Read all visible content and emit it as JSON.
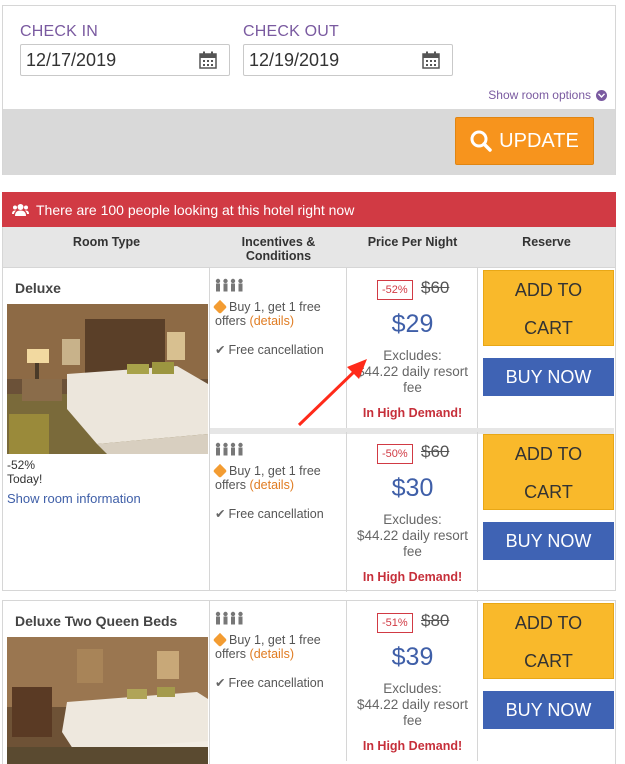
{
  "search": {
    "check_in_label": "CHECK IN",
    "check_in_value": "12/17/2019",
    "check_out_label": "CHECK OUT",
    "check_out_value": "12/19/2019",
    "room_options_label": "Show room options",
    "update_label": "UPDATE"
  },
  "alert": {
    "text": "There are 100 people looking at this hotel right now"
  },
  "table_header": {
    "room_type": "Room Type",
    "incentives_line1": "Incentives &",
    "incentives_line2": "Conditions",
    "price": "Price Per Night",
    "reserve": "Reserve"
  },
  "rooms": [
    {
      "name": "Deluxe",
      "discount_text": "-52%",
      "today_text": "Today!",
      "show_info": "Show room information",
      "rates": [
        {
          "offer": "Buy 1, get 1 free offers",
          "details": "(details)",
          "cancellation": "Free cancellation",
          "discount": "-52%",
          "old_price": "$60",
          "price": "$29",
          "excludes_1": "Excludes:",
          "excludes_2": "$44.22 daily resort",
          "excludes_3": "fee",
          "demand": "In High Demand!",
          "add_line1": "ADD TO",
          "add_line2": "CART",
          "buy": "BUY NOW"
        },
        {
          "offer": "Buy 1, get 1 free offers",
          "details": "(details)",
          "cancellation": "Free cancellation",
          "discount": "-50%",
          "old_price": "$60",
          "price": "$30",
          "excludes_1": "Excludes:",
          "excludes_2": "$44.22 daily resort",
          "excludes_3": "fee",
          "demand": "In High Demand!",
          "add_line1": "ADD TO",
          "add_line2": "CART",
          "buy": "BUY NOW"
        }
      ]
    },
    {
      "name": "Deluxe Two Queen Beds",
      "rates": [
        {
          "offer": "Buy 1, get 1 free offers",
          "details": "(details)",
          "cancellation": "Free cancellation",
          "discount": "-51%",
          "old_price": "$80",
          "price": "$39",
          "excludes_1": "Excludes:",
          "excludes_2": "$44.22 daily resort",
          "excludes_3": "fee",
          "demand": "In High Demand!",
          "add_line1": "ADD TO",
          "add_line2": "CART",
          "buy": "BUY NOW"
        }
      ]
    }
  ],
  "colors": {
    "accent_purple": "#7a5aa0",
    "update_orange": "#f7941d",
    "alert_red": "#d13a44",
    "price_blue": "#3f5fa8",
    "cart_yellow": "#f9b92b",
    "buy_blue": "#3f63b4"
  },
  "icons": {
    "calendar": "calendar-icon",
    "chevron": "chevron-down-icon",
    "search": "search-icon",
    "people": "people-icon",
    "tag": "tag-icon",
    "check": "check-icon"
  }
}
